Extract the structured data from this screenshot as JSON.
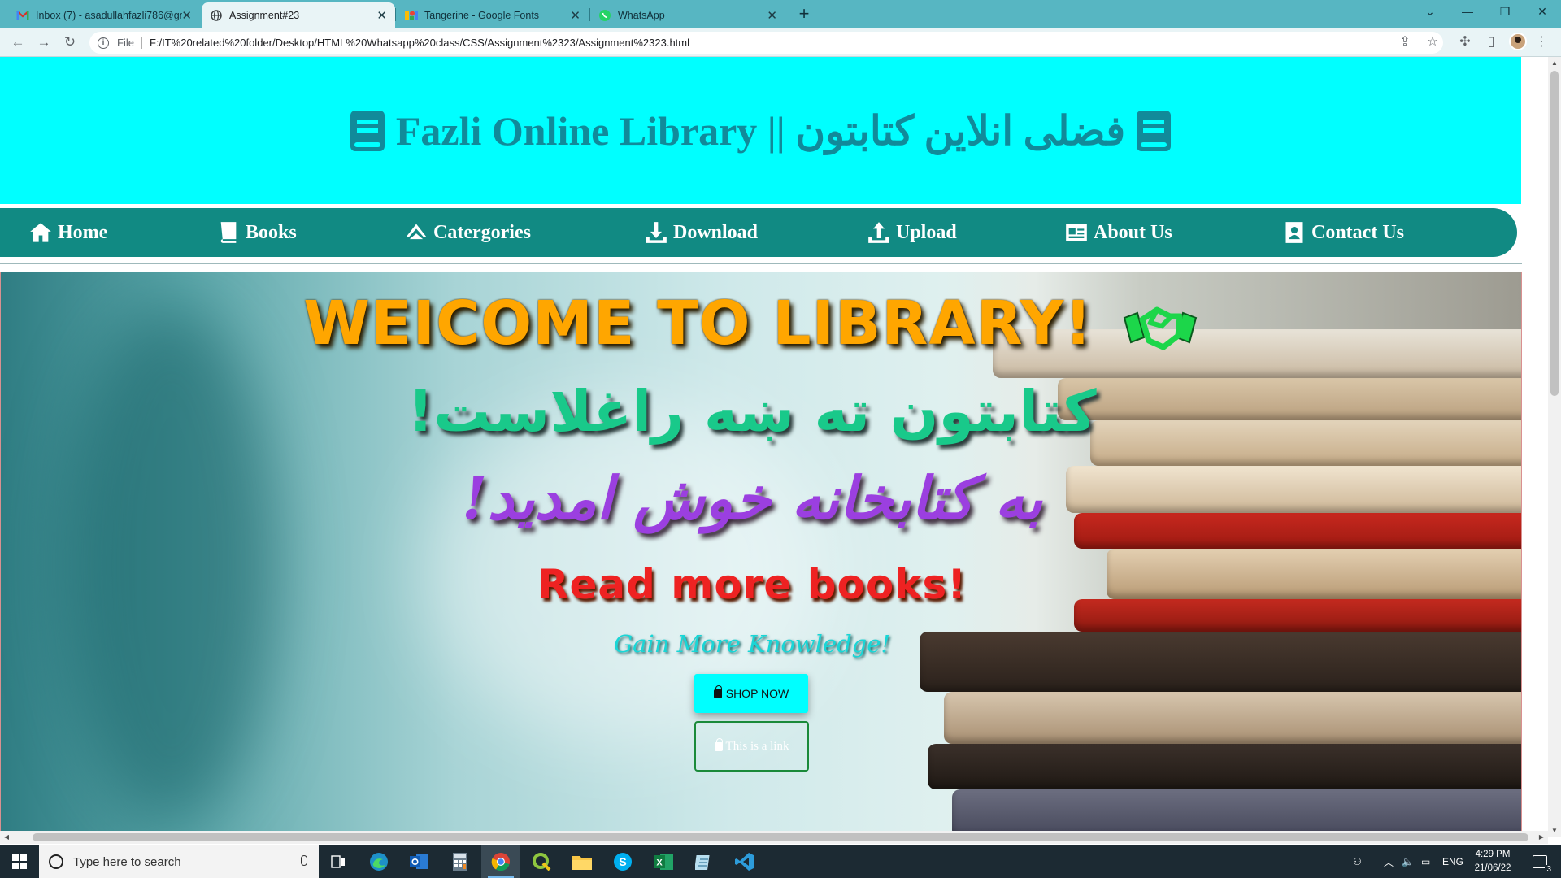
{
  "browser": {
    "tabs": [
      {
        "label": "Inbox (7) - asadullahfazli786@gm",
        "icon": "gmail-icon",
        "active": false
      },
      {
        "label": "Assignment#23",
        "icon": "globe-icon",
        "active": true
      },
      {
        "label": "Tangerine - Google Fonts",
        "icon": "google-fonts-icon",
        "active": false
      },
      {
        "label": "WhatsApp",
        "icon": "whatsapp-icon",
        "active": false
      }
    ],
    "new_tab_label": "+",
    "scheme_label": "File",
    "url": "F:/IT%20related%20folder/Desktop/HTML%20Whatsapp%20class/CSS/Assignment%2323/Assignment%2323.html"
  },
  "page": {
    "site_title": "Fazli Online Library || فضلی انلاین کتابتون",
    "nav": [
      {
        "label": "Home",
        "icon": "home-icon"
      },
      {
        "label": "Books",
        "icon": "book-icon"
      },
      {
        "label": "Catergories",
        "icon": "categories-icon"
      },
      {
        "label": "Download",
        "icon": "download-icon"
      },
      {
        "label": "Upload",
        "icon": "upload-icon"
      },
      {
        "label": "About Us",
        "icon": "id-card-icon"
      },
      {
        "label": "Contact Us",
        "icon": "contact-icon"
      }
    ],
    "hero": {
      "welcome": "WEICOME TO LIBRARY!",
      "pashto_line1": "کتابتون ته ښه راغلاست!",
      "pashto_line2": "به کتابخانه خوش امدید!",
      "read_more": "Read more books!",
      "gain_knowledge": "Gain More Knowledge!",
      "shop_button": "SHOP NOW",
      "link_button": "This is a link"
    }
  },
  "taskbar": {
    "search_placeholder": "Type here to search",
    "language": "ENG",
    "time": "4:29 PM",
    "date": "21/06/22",
    "notification_count": "3"
  },
  "colors": {
    "header_bg": "#00ffff",
    "title_color": "#118a9a",
    "navbar_bg": "#118a83",
    "welcome_color": "#ffa600",
    "pashto1_color": "#19c98a",
    "pashto2_color": "#9b3fe0",
    "read_more_color": "#ee2222",
    "knowledge_color": "#19d6d6",
    "tabstrip_bg": "#57b6c2"
  }
}
